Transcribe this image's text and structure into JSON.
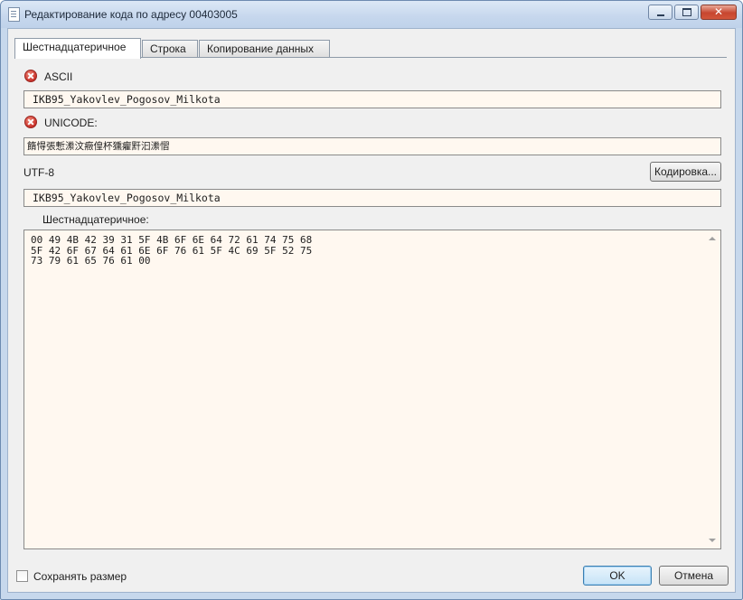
{
  "window": {
    "title": "Редактирование кода по адресу 00403005",
    "controls": {
      "minimize": "minimize",
      "maximize": "maximize",
      "close": "✕"
    }
  },
  "tabs": [
    {
      "label": "Шестнадцатеричное",
      "active": true
    },
    {
      "label": "Строка",
      "active": false
    },
    {
      "label": "Копирование данных",
      "active": false
    }
  ],
  "ascii": {
    "label": "ASCII",
    "value": "IKB95_Yakovlev_Pogosov_Milkota",
    "status_icon": "error-icon"
  },
  "unicode": {
    "label": "UNICODE:",
    "value": "䭉㥂張慙潫汶癥偟杯獯癯䵟汩潫慴",
    "status_icon": "error-icon"
  },
  "utf8": {
    "label": "UTF-8",
    "value": "IKB95_Yakovlev_Pogosov_Milkota",
    "encoding_button": "Кодировка..."
  },
  "hex": {
    "label": "Шестнадцатеричное:",
    "lines": [
      "00 49 4B 42 39 31 5F 4B 6F 6E 64 72 61 74 75 68",
      "5F 42 6F 67 64 61 6E 6F 76 61 5F 4C 69 5F 52 75",
      "73 79 61 65 76 61 00"
    ]
  },
  "footer": {
    "keep_size_label": "Сохранять размер",
    "keep_size_checked": false,
    "ok_label": "OK",
    "cancel_label": "Отмена"
  }
}
